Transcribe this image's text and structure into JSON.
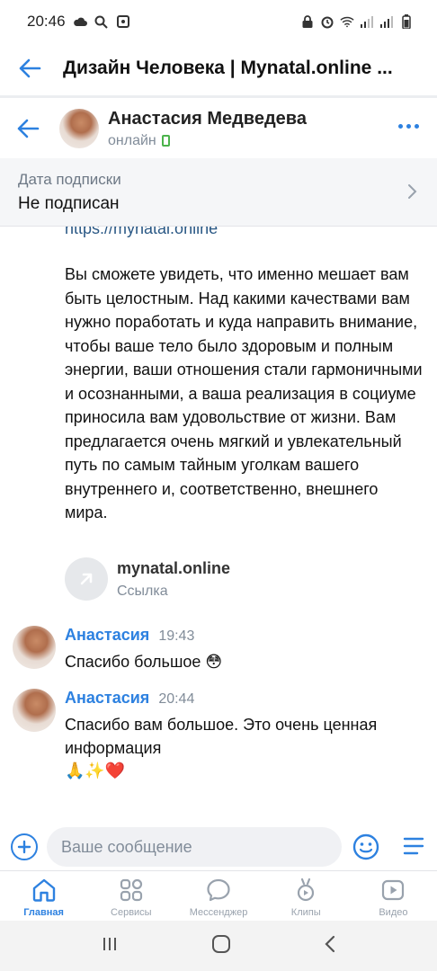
{
  "status_bar": {
    "time": "20:46"
  },
  "app_header": {
    "title": "Дизайн Человека | Mynatal.online ..."
  },
  "chat_header": {
    "peer_name": "Анастасия Медведева",
    "peer_status": "онлайн"
  },
  "subscription": {
    "label": "Дата подписки",
    "value": "Не подписан"
  },
  "messages": {
    "link_text": "https://mynatal.online",
    "body_text": "Вы сможете увидеть, что именно мешает вам быть целостным. Над какими качествами вам нужно поработать и куда направить внимание, чтобы ваше тело было здоровым и полным энергии, ваши отношения стали гармоничными и осознанными, а ваша реализация в социуме приносила вам удовольствие от жизни. Вам предлагается очень мягкий и увлекательный путь по самым тайным уголкам вашего внутреннего и, соответственно, внешнего мира.",
    "attachment": {
      "title": "mynatal.online",
      "subtitle": "Ссылка"
    },
    "items": [
      {
        "author": "Анастасия",
        "time": "19:43",
        "text": "Спасибо большое",
        "emoji": "😳"
      },
      {
        "author": "Анастасия",
        "time": "20:44",
        "text": "Спасибо вам большое. Это очень ценная информация",
        "emoji": "🙏✨❤️"
      }
    ]
  },
  "composer": {
    "placeholder": "Ваше сообщение"
  },
  "tabbar": {
    "items": [
      {
        "label": "Главная",
        "icon": "home-icon"
      },
      {
        "label": "Сервисы",
        "icon": "services-icon"
      },
      {
        "label": "Мессенджер",
        "icon": "messenger-icon"
      },
      {
        "label": "Клипы",
        "icon": "clips-icon"
      },
      {
        "label": "Видео",
        "icon": "video-icon"
      }
    ]
  },
  "colors": {
    "accent": "#2d81e0",
    "link": "#2a5885",
    "online": "#4bb34b",
    "muted": "#818c99"
  }
}
